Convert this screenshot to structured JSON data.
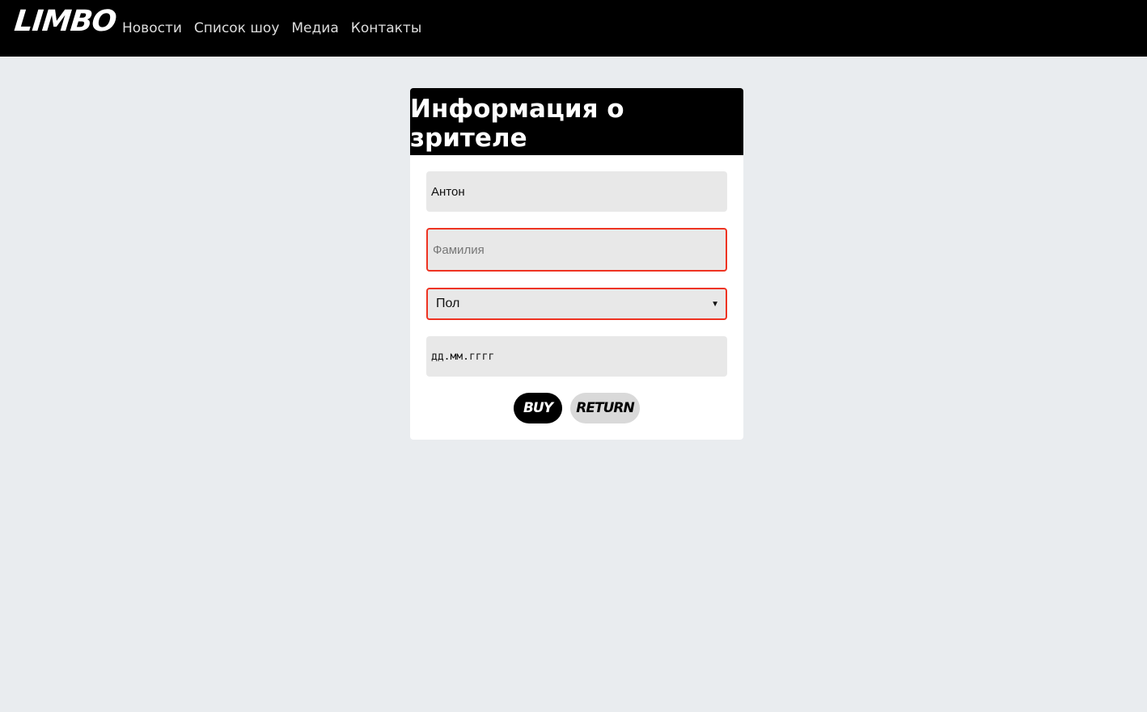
{
  "nav": {
    "logo": "LIMBO",
    "links": [
      "Новости",
      "Список шоу",
      "Медиа",
      "Контакты"
    ]
  },
  "form": {
    "title": "Информация о зрителе",
    "first_name_value": "Антон",
    "last_name_placeholder": "Фамилия",
    "gender_selected": "Пол",
    "birthdate_placeholder": "дд.мм.гггг",
    "buy_label": "BUY",
    "return_label": "RETURN"
  },
  "colors": {
    "error_border": "#ee3322",
    "background": "#e9ecef"
  }
}
